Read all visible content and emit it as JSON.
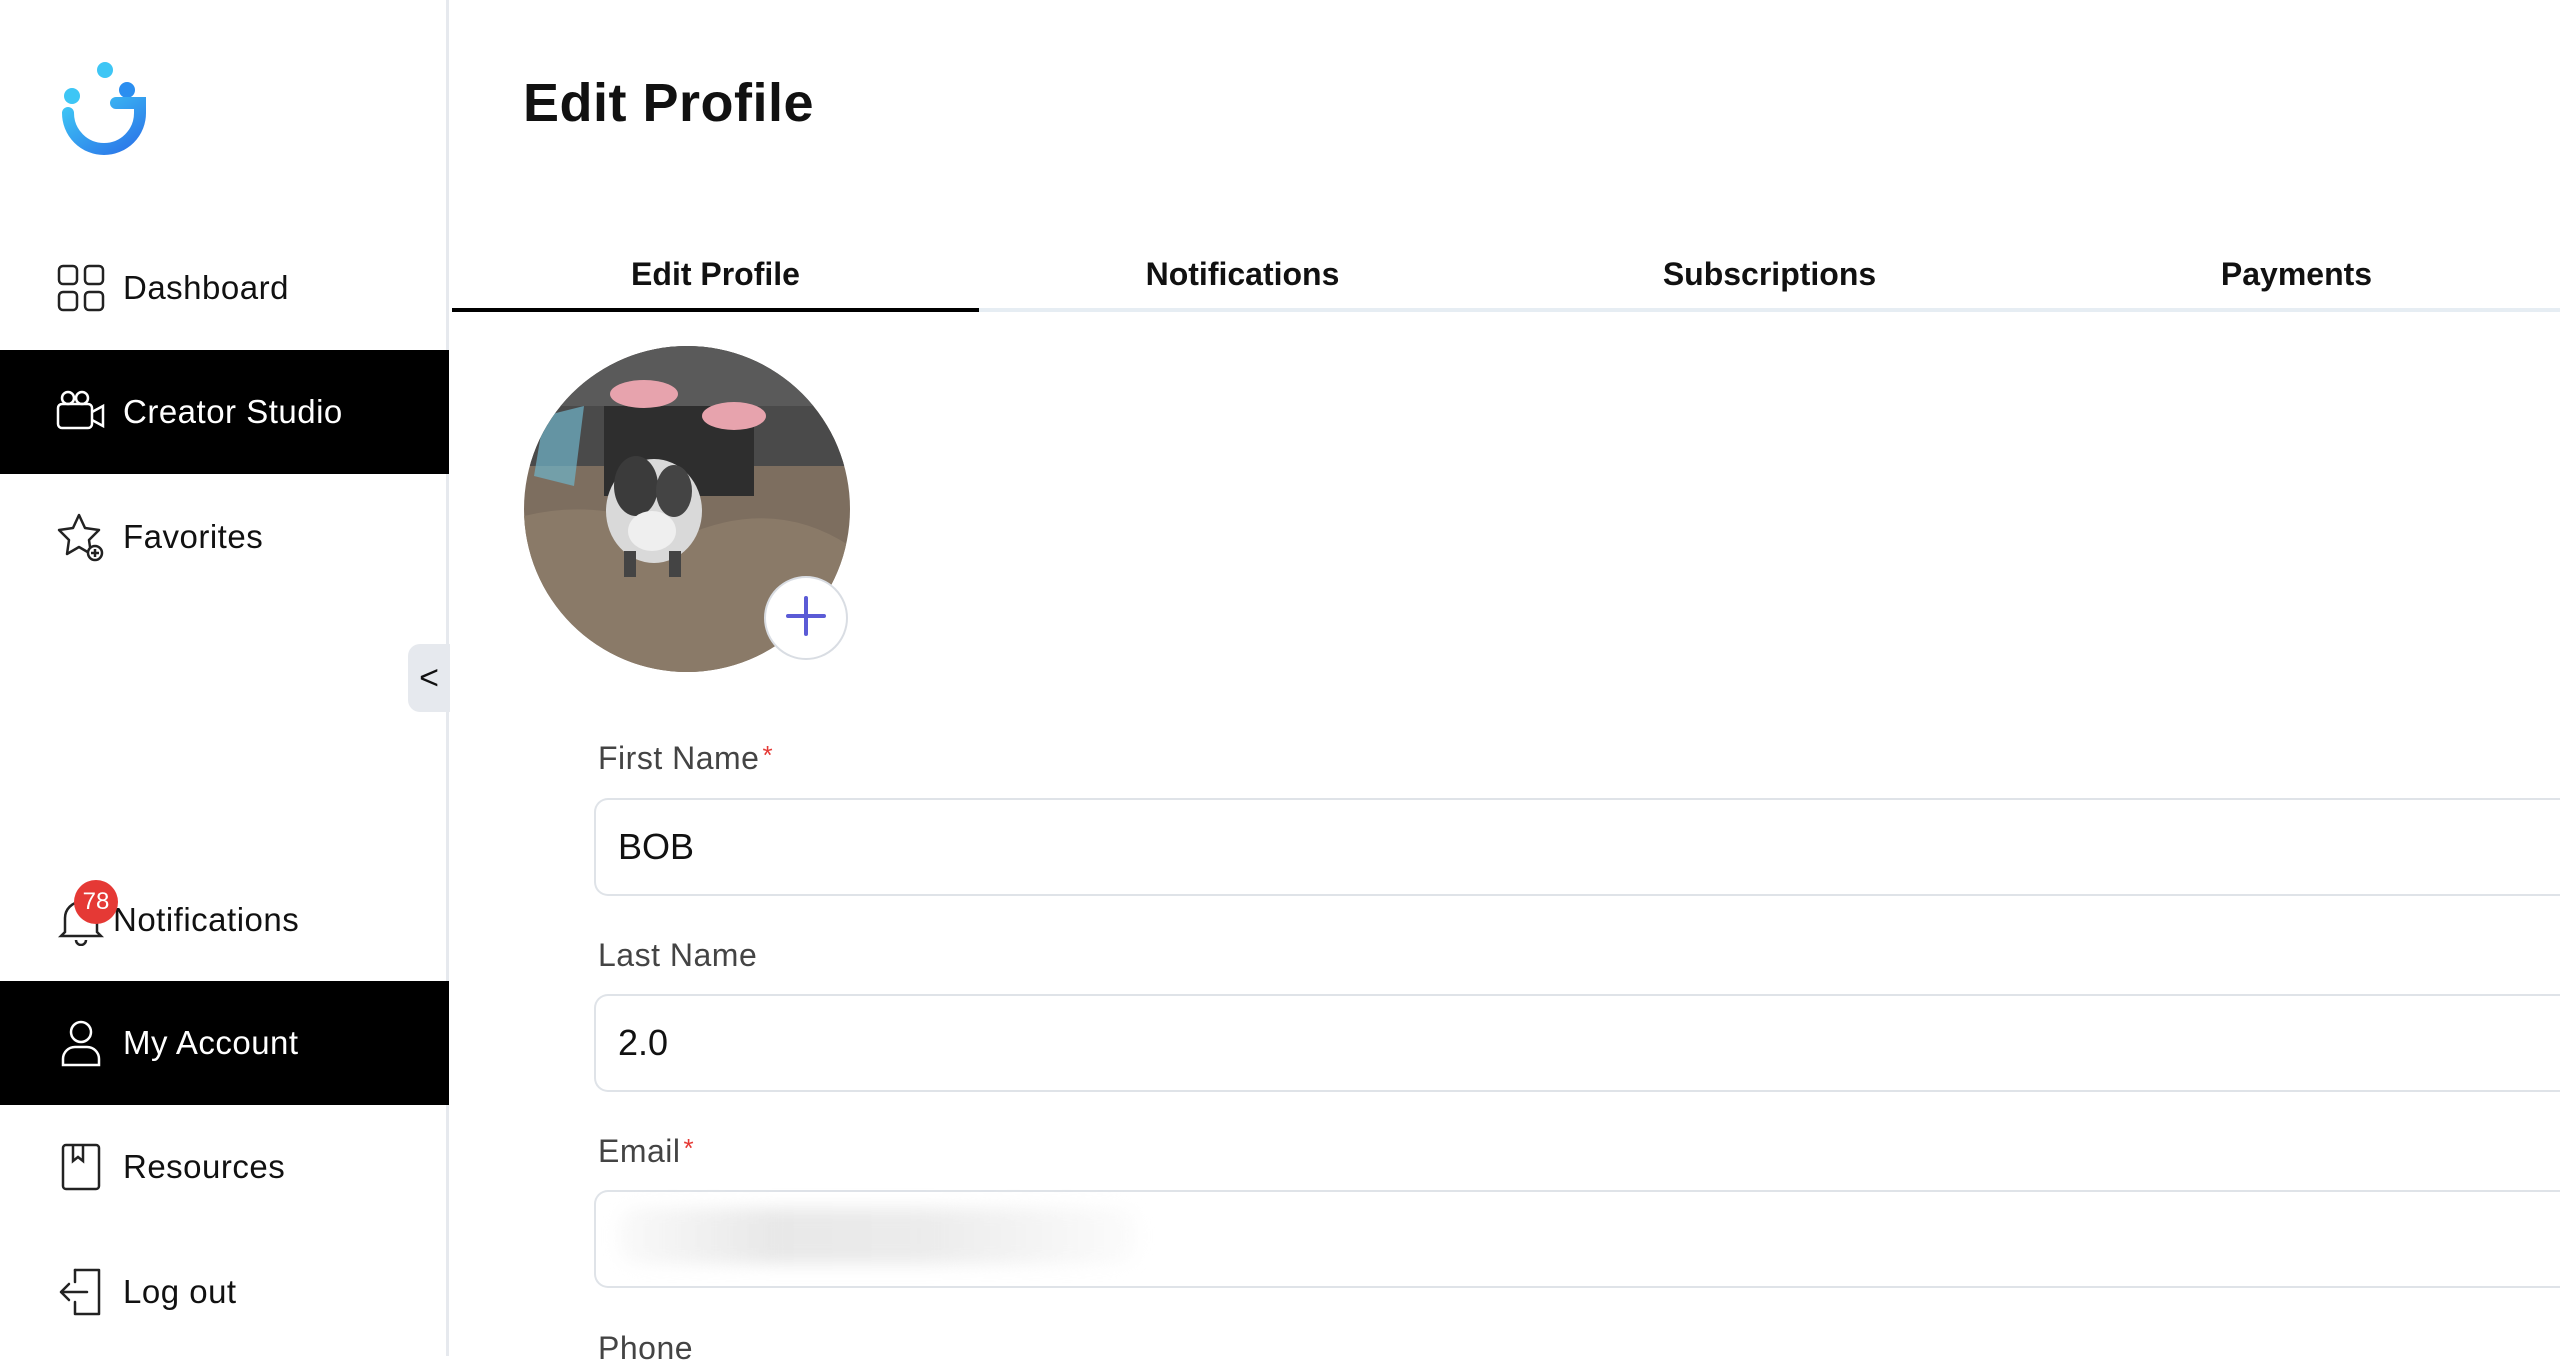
{
  "sidebar": {
    "nav_top": [
      {
        "label": "Dashboard",
        "icon": "grid-icon",
        "active": false
      },
      {
        "label": "Creator Studio",
        "icon": "camera-icon",
        "active": true
      },
      {
        "label": "Favorites",
        "icon": "star-icon",
        "active": false
      }
    ],
    "collapse_label": "<",
    "notifications": {
      "label": "Notifications",
      "count": "78"
    },
    "nav_bottom": [
      {
        "label": "My Account",
        "icon": "user-icon",
        "active": true
      },
      {
        "label": "Resources",
        "icon": "bookmark-icon",
        "active": false
      },
      {
        "label": "Log out",
        "icon": "logout-icon",
        "active": false
      }
    ]
  },
  "page": {
    "title": "Edit Profile",
    "tabs": [
      {
        "label": "Edit Profile",
        "active": true
      },
      {
        "label": "Notifications",
        "active": false
      },
      {
        "label": "Subscriptions",
        "active": false
      },
      {
        "label": "Payments",
        "active": false
      }
    ]
  },
  "form": {
    "first_name": {
      "label": "First Name",
      "required": "*",
      "value": "BOB"
    },
    "last_name": {
      "label": "Last Name",
      "value": "2.0"
    },
    "email": {
      "label": "Email",
      "required": "*",
      "value": ""
    },
    "phone": {
      "label": "Phone"
    }
  },
  "colors": {
    "active_nav_bg": "#000000",
    "badge": "#e53935",
    "accent_plus": "#5b5bd6",
    "logo_blue": "#3aa8f2"
  }
}
